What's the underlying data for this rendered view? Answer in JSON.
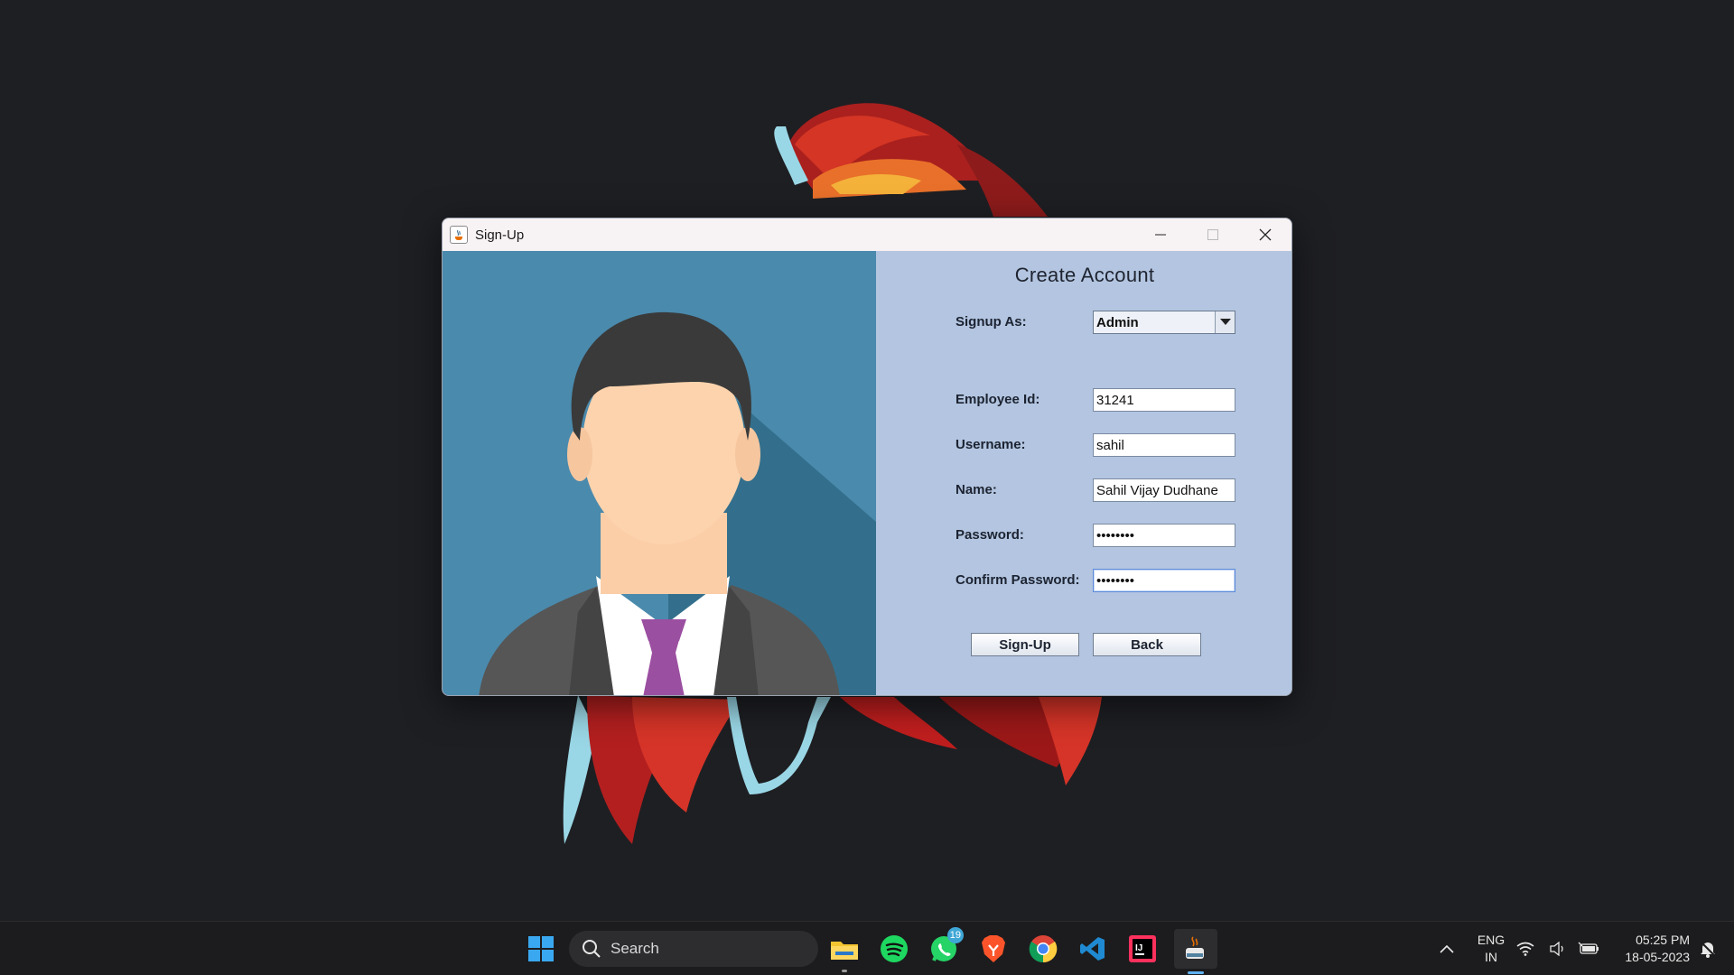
{
  "window": {
    "title": "Sign-Up",
    "heading": "Create Account"
  },
  "form": {
    "signup_as": {
      "label": "Signup As:",
      "value": "Admin"
    },
    "employee_id": {
      "label": "Employee Id:",
      "value": "31241"
    },
    "username": {
      "label": "Username:",
      "value": "sahil"
    },
    "name": {
      "label": "Name:",
      "value": "Sahil Vijay Dudhane"
    },
    "password": {
      "label": "Password:",
      "value": "••••••••"
    },
    "confirm_password": {
      "label": "Confirm Password:",
      "value": "••••••••"
    }
  },
  "buttons": {
    "signup": "Sign-Up",
    "back": "Back"
  },
  "taskbar": {
    "search_label": "Search",
    "whatsapp_badge": "19",
    "language": "ENG",
    "region": "IN",
    "time": "05:25 PM",
    "date": "18-05-2023",
    "icons": [
      "start-icon",
      "search-icon",
      "file-explorer-icon",
      "spotify-icon",
      "whatsapp-icon",
      "brave-icon",
      "chrome-icon",
      "vscode-icon",
      "intellij-icon",
      "java-icon",
      "chevron-up-icon",
      "wifi-icon",
      "volume-icon",
      "battery-icon",
      "notification-icon"
    ]
  },
  "colors": {
    "desktop": "#1e1f23",
    "form_panel": "#b3c5e0",
    "image_panel": "#4a8aad",
    "titlebar": "#f7f2f3",
    "taskbar": "#1c1c1e"
  }
}
